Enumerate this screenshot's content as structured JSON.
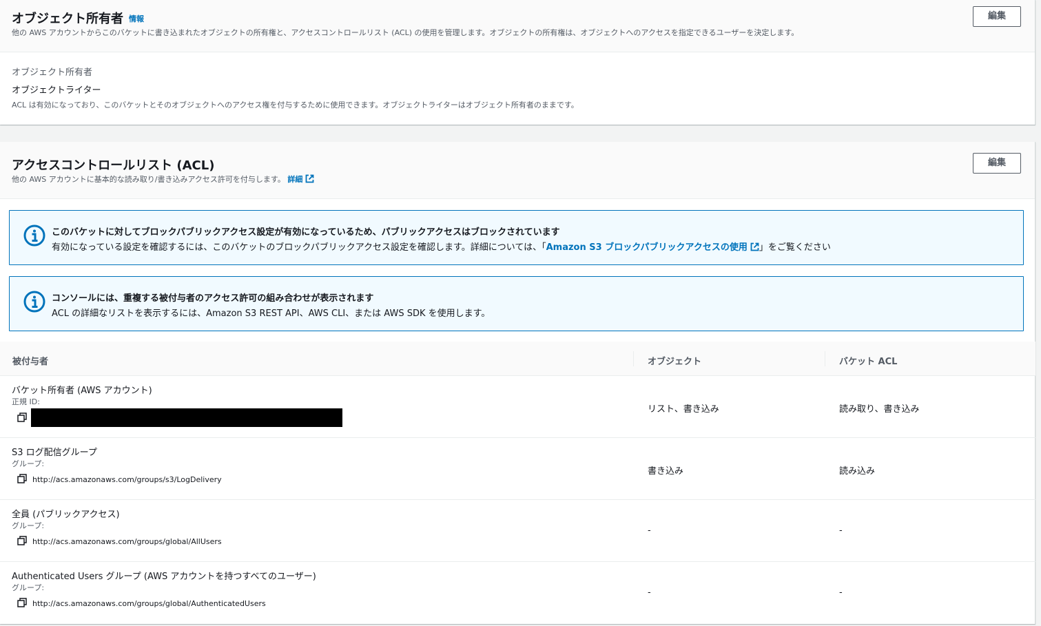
{
  "object_ownership": {
    "title": "オブジェクト所有者",
    "info_link": "情報",
    "description": "他の AWS アカウントからこのバケットに書き込まれたオブジェクトの所有権と、アクセスコントロールリスト (ACL) の使用を管理します。オブジェクトの所有権は、オブジェクトへのアクセスを指定できるユーザーを決定します。",
    "edit_label": "編集",
    "field_label": "オブジェクト所有者",
    "field_value": "オブジェクトライター",
    "field_note": "ACL は有効になっており、このバケットとそのオブジェクトへのアクセス権を付与するために使用できます。オブジェクトライターはオブジェクト所有者のままです。"
  },
  "acl": {
    "title": "アクセスコントロールリスト (ACL)",
    "description": "他の AWS アカウントに基本的な読み取り/書き込みアクセス許可を付与します。",
    "details_link": "詳細",
    "edit_label": "編集",
    "alert1": {
      "title": "このバケットに対してブロックパブリックアクセス設定が有効になっているため、パブリックアクセスはブロックされています",
      "body_prefix": "有効になっている設定を確認するには、このバケットのブロックパブリックアクセス設定を確認します。詳細については、「",
      "body_link": "Amazon S3 ブロックパブリックアクセスの使用",
      "body_suffix": "」をご覧ください"
    },
    "alert2": {
      "title": "コンソールには、重複する被付与者のアクセス許可の組み合わせが表示されます",
      "body": "ACL の詳細なリストを表示するには、Amazon S3 REST API、AWS CLI、または AWS SDK を使用します。"
    },
    "columns": [
      "被付与者",
      "オブジェクト",
      "バケット ACL"
    ],
    "rows": [
      {
        "grantee": "バケット所有者 (AWS アカウント)",
        "kind": "正規 ID:",
        "value": "",
        "object": "リスト、書き込み",
        "bucket_acl": "読み取り、書き込み"
      },
      {
        "grantee": "S3 ログ配信グループ",
        "kind": "グループ:",
        "value": "http://acs.amazonaws.com/groups/s3/LogDelivery",
        "object": "書き込み",
        "bucket_acl": "読み込み"
      },
      {
        "grantee": "全員 (パブリックアクセス)",
        "kind": "グループ:",
        "value": "http://acs.amazonaws.com/groups/global/AllUsers",
        "object": "-",
        "bucket_acl": "-"
      },
      {
        "grantee": "Authenticated Users グループ (AWS アカウントを持つすべてのユーザー)",
        "kind": "グループ:",
        "value": "http://acs.amazonaws.com/groups/global/AuthenticatedUsers",
        "object": "-",
        "bucket_acl": "-"
      }
    ]
  },
  "colors": {
    "link": "#0073bb",
    "alert_bg": "#f1faff",
    "alert_border": "#0073bb",
    "text": "#16191f",
    "muted": "#545b64"
  },
  "icons": {
    "info": "info-circle-icon",
    "external": "external-link-icon",
    "copy": "copy-icon"
  }
}
